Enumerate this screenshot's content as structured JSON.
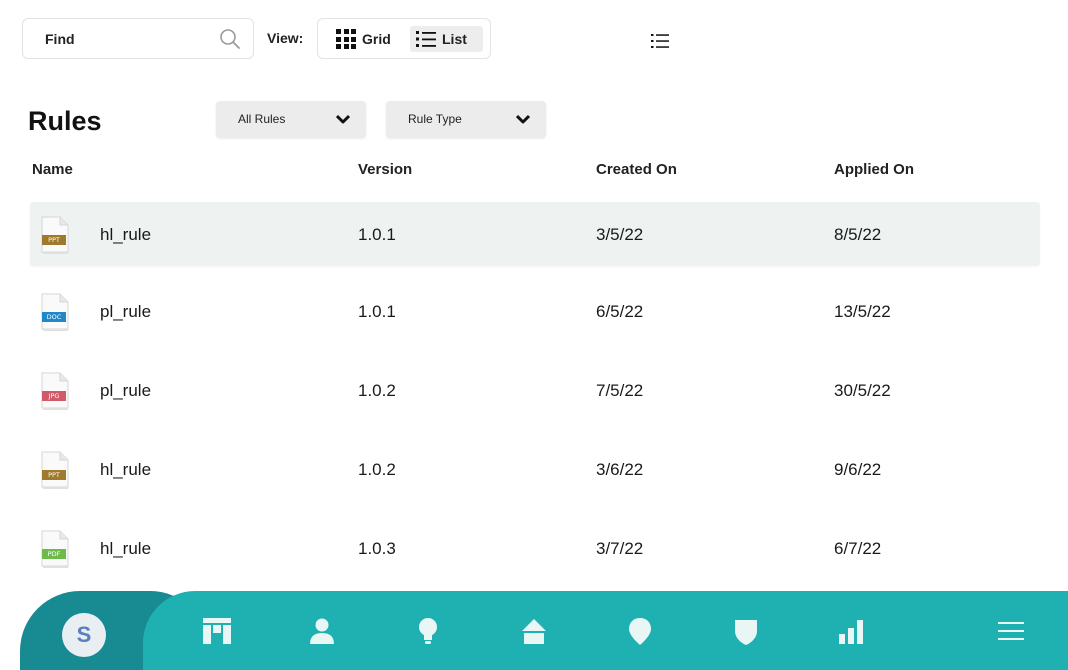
{
  "toolbar": {
    "find_placeholder": "Find",
    "view_label": "View:",
    "grid_label": "Grid",
    "list_label": "List",
    "active_view": "List"
  },
  "header": {
    "title": "Rules",
    "filter_all": "All Rules",
    "filter_type": "Rule Type"
  },
  "table": {
    "columns": [
      "Name",
      "Version",
      "Created On",
      "Applied On"
    ],
    "rows": [
      {
        "file_type": "PPT",
        "name": "hl_rule",
        "version": "1.0.1",
        "created": "3/5/22",
        "applied": "8/5/22",
        "selected": true
      },
      {
        "file_type": "DOC",
        "name": "pl_rule",
        "version": "1.0.1",
        "created": "6/5/22",
        "applied": "13/5/22",
        "selected": false
      },
      {
        "file_type": "JPG",
        "name": "pl_rule",
        "version": "1.0.2",
        "created": "7/5/22",
        "applied": "30/5/22",
        "selected": false
      },
      {
        "file_type": "PPT",
        "name": "hl_rule",
        "version": "1.0.2",
        "created": "3/6/22",
        "applied": "9/6/22",
        "selected": false
      },
      {
        "file_type": "PDF",
        "name": "hl_rule",
        "version": "1.0.3",
        "created": "3/7/22",
        "applied": "6/7/22",
        "selected": false
      }
    ]
  },
  "bottom_nav": {
    "avatar_initial": "S",
    "icons": [
      "dashboard-icon",
      "user-icon",
      "lightbulb-icon",
      "home-icon",
      "location-pin-icon",
      "shield-icon",
      "bar-chart-icon",
      "hamburger-menu-icon"
    ]
  },
  "colors": {
    "nav_primary": "#1fb1b1",
    "nav_dark": "#188a92",
    "row_selected": "#eef2f1",
    "ppt": "#a07a2c",
    "doc": "#1e88c8",
    "jpg": "#d05a6a",
    "pdf": "#6dbb4d"
  }
}
